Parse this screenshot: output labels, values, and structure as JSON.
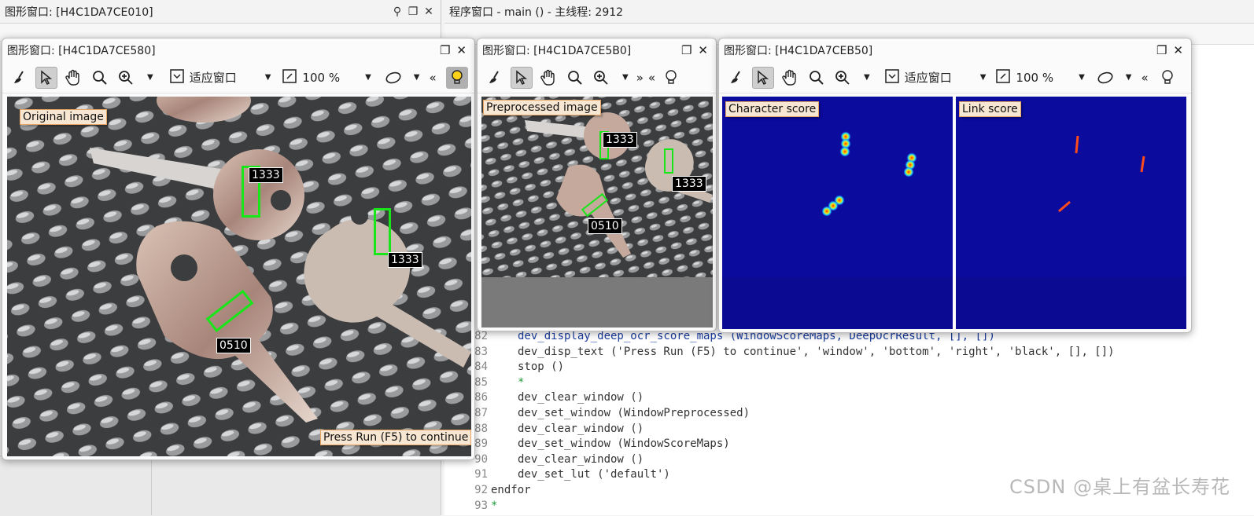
{
  "bg_graphics_window": {
    "title": "图形窗口: [H4C1DA7CE010]"
  },
  "program_window": {
    "title": "程序窗口 - main () - 主线程: 2912"
  },
  "win_original": {
    "title": "图形窗口: [H4C1DA7CE580]",
    "fit_label": "适应窗口",
    "zoom": "100 %",
    "labels": {
      "original": "Original image",
      "continue": "Press Run (F5) to continue"
    },
    "ocr": [
      "1333",
      "1333",
      "0510"
    ]
  },
  "win_preprocessed": {
    "title": "图形窗口: [H4C1DA7CE5B0]",
    "labels": {
      "preprocessed": "Preprocessed image"
    },
    "ocr": [
      "1333",
      "1333",
      "0510"
    ]
  },
  "win_scores": {
    "title": "图形窗口: [H4C1DA7CEB50]",
    "fit_label": "适应窗口",
    "zoom": "100 %",
    "labels": {
      "character": "Character score",
      "link": "Link score"
    }
  },
  "code_lines": [
    {
      "no": "82",
      "text": "dev_display_deep_ocr_score_maps (WindowScoreMaps, DeepOcrResult, [], [])"
    },
    {
      "no": "83",
      "text": "dev_disp_text ('Press Run (F5) to continue', 'window', 'bottom', 'right', 'black', [], [])"
    },
    {
      "no": "84",
      "text": "stop ()"
    },
    {
      "no": "85",
      "text": "*"
    },
    {
      "no": "86",
      "text": "dev_clear_window ()"
    },
    {
      "no": "87",
      "text": "dev_set_window (WindowPreprocessed)"
    },
    {
      "no": "88",
      "text": "dev_clear_window ()"
    },
    {
      "no": "89",
      "text": "dev_set_window (WindowScoreMaps)"
    },
    {
      "no": "90",
      "text": "dev_clear_window ()"
    },
    {
      "no": "91",
      "text": "dev_set_lut ('default')"
    },
    {
      "no": "92",
      "text": "endfor"
    },
    {
      "no": "93",
      "text": "*"
    }
  ],
  "watermark": "CSDN @桌上有盆长寿花",
  "colors": {
    "accent_green": "#19e619",
    "label_bg": "#f6e6d2",
    "score_bg": "#0a0a9a"
  }
}
